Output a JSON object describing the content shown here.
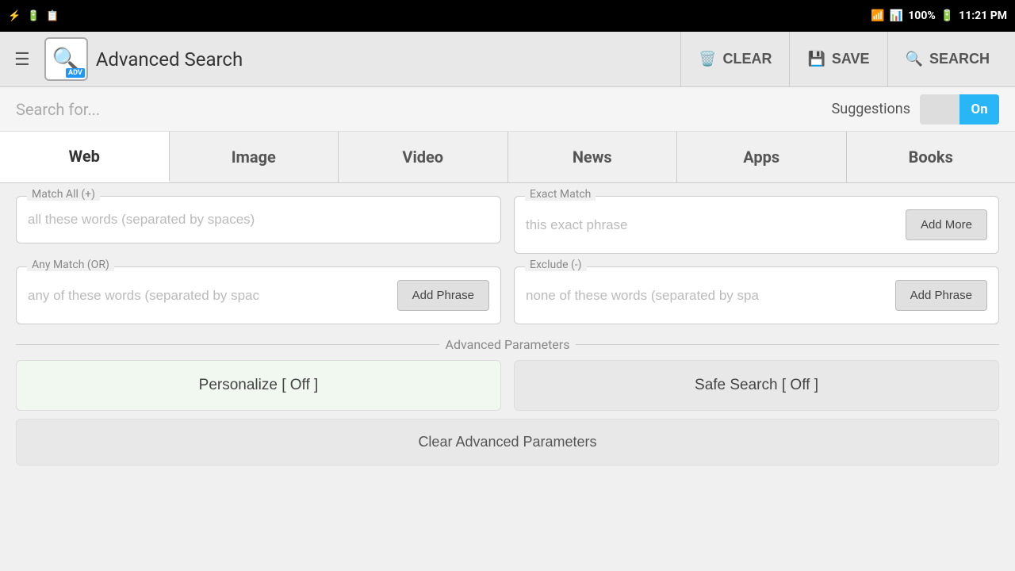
{
  "statusBar": {
    "time": "11:21 PM",
    "battery": "100%",
    "signal": "WiFi",
    "usb_icon": "⚡",
    "battery_icon": "🔋"
  },
  "toolbar": {
    "app_icon_label": "ADV",
    "title": "Advanced Search",
    "clear_btn": "CLEAR",
    "save_btn": "SAVE",
    "search_btn": "SEARCH"
  },
  "search_for": {
    "placeholder": "Search for...",
    "suggestions_label": "Suggestions",
    "toggle_label": "On"
  },
  "tabs": [
    {
      "id": "web",
      "label": "Web",
      "active": true
    },
    {
      "id": "image",
      "label": "Image",
      "active": false
    },
    {
      "id": "video",
      "label": "Video",
      "active": false
    },
    {
      "id": "news",
      "label": "News",
      "active": false
    },
    {
      "id": "apps",
      "label": "Apps",
      "active": false
    },
    {
      "id": "books",
      "label": "Books",
      "active": false
    }
  ],
  "fields": {
    "match_all": {
      "label": "Match All (+)",
      "placeholder": "all these words (separated by spaces)"
    },
    "exact_match": {
      "label": "Exact Match",
      "placeholder": "this exact phrase",
      "add_more": "Add More"
    },
    "any_match": {
      "label": "Any Match (OR)",
      "placeholder": "any of these words (separated by spac",
      "add_phrase": "Add Phrase"
    },
    "exclude": {
      "label": "Exclude (-)",
      "placeholder": "none of these words (separated by spa",
      "add_phrase": "Add Phrase"
    }
  },
  "advanced_params": {
    "section_label": "Advanced Parameters",
    "personalize_btn": "Personalize [ Off ]",
    "safe_search_btn": "Safe Search [ Off ]",
    "clear_params_btn": "Clear Advanced Parameters"
  }
}
